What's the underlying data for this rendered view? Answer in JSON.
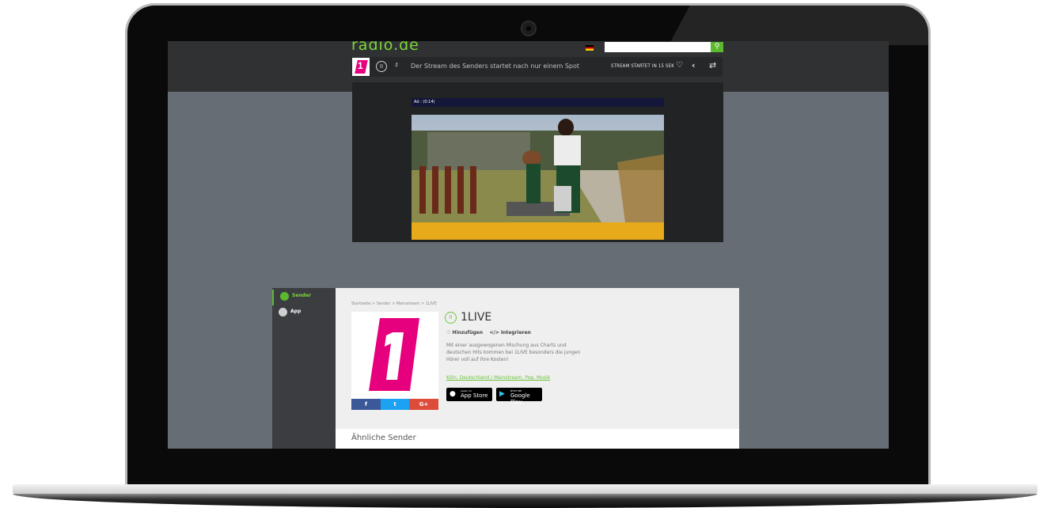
{
  "site": {
    "logo": "radio.de",
    "search_icon": "search-icon"
  },
  "player": {
    "message": "Der Stream des Senders startet nach nur einem Spot",
    "stream_status": "STREAM STARTET IN 15 SEK",
    "icons": [
      "pause-icon",
      "volume-icon",
      "heart-icon",
      "share-icon",
      "shuffle-icon"
    ]
  },
  "ad": {
    "label": "Ad : (0:14)"
  },
  "sidenav": {
    "items": [
      {
        "label": "Sender",
        "icon": "radio-tower-icon",
        "color": "#5cb82f"
      },
      {
        "label": "App",
        "icon": "phone-icon",
        "color": "#cfcfcf"
      }
    ]
  },
  "station": {
    "breadcrumb": "Startseite > Sender > Mainstream > 1LIVE",
    "name": "1LIVE",
    "add_label": "Hinzufügen",
    "embed_label": "</> Integrieren",
    "description": "Mit einer ausgewogenen Mischung aus Charts und deutschen Hits kommen bei 1LIVE besonders die jungen Hörer voll auf ihre Kosten!",
    "tags": "Köln, Deutschland / Mainstream, Pop, Musik",
    "appstore_small": "Laden im",
    "appstore_big": "App Store",
    "playstore_small": "JETZT BEI",
    "playstore_big": "Google Play",
    "social": {
      "facebook": "f",
      "twitter": "t",
      "googleplus": "G+"
    },
    "brand_color": "#e6007e"
  },
  "similar": {
    "title": "Ähnliche Sender"
  }
}
